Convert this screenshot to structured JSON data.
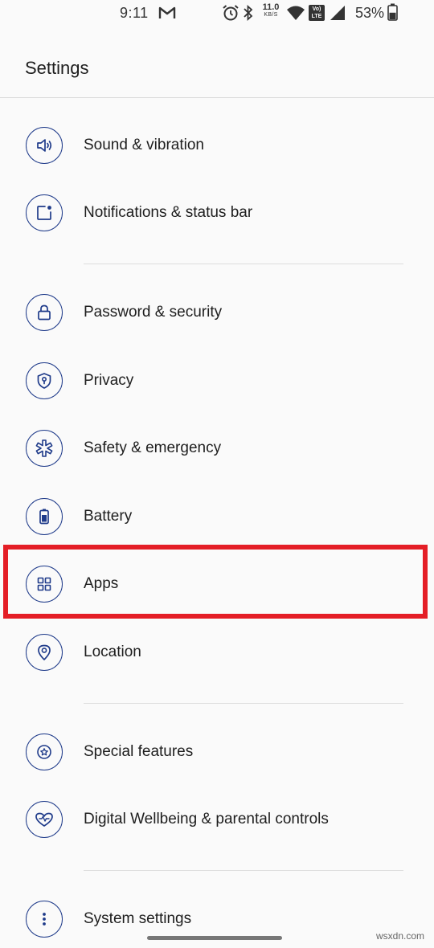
{
  "status_bar": {
    "time": "9:11",
    "net_speed_value": "11.0",
    "net_speed_unit": "KB/S",
    "volte_line1": "Vo)",
    "volte_line2": "LTE",
    "battery_percent": "53%",
    "battery_level": 0.53
  },
  "header": {
    "title": "Settings"
  },
  "items": [
    {
      "label": "Sound & vibration",
      "icon": "speaker-icon"
    },
    {
      "label": "Notifications & status bar",
      "icon": "notification-icon"
    },
    {
      "label": "Password & security",
      "icon": "lock-icon"
    },
    {
      "label": "Privacy",
      "icon": "privacy-shield-icon"
    },
    {
      "label": "Safety & emergency",
      "icon": "emergency-asterisk-icon"
    },
    {
      "label": "Battery",
      "icon": "battery-icon"
    },
    {
      "label": "Apps",
      "icon": "apps-grid-icon"
    },
    {
      "label": "Location",
      "icon": "location-pin-icon"
    },
    {
      "label": "Special features",
      "icon": "star-badge-icon"
    },
    {
      "label": "Digital Wellbeing & parental controls",
      "icon": "heart-icon"
    },
    {
      "label": "System settings",
      "icon": "more-vertical-icon"
    }
  ],
  "watermark": "wsxdn.com",
  "colors": {
    "accent": "#1f3b8a",
    "highlight": "#e41e26",
    "background": "#fafafa"
  }
}
